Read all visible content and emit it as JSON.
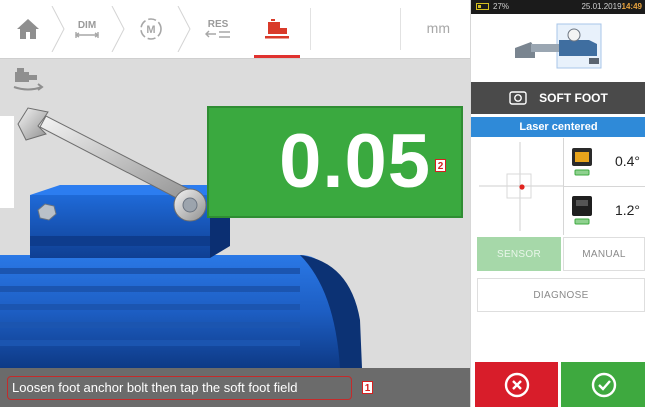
{
  "toolbar": {
    "dim_label": "DIM",
    "res_label": "RES",
    "units": "mm"
  },
  "measurement": {
    "value": "0.05",
    "callout": "2"
  },
  "status_bar": {
    "instruction": "Loosen foot anchor bolt then tap the soft foot field",
    "callout": "1"
  },
  "device_status": {
    "battery": "27%",
    "date": "25.01.2019",
    "time": "14:49"
  },
  "panel": {
    "title": "SOFT FOOT",
    "laser_status": "Laser centered",
    "angle_top": "0.4°",
    "angle_bottom": "1.2°",
    "sensor_label": "SENSOR",
    "manual_label": "MANUAL",
    "diagnose_label": "DIAGNOSE"
  },
  "colors": {
    "value_box": "#3aa93f",
    "laser_bar": "#2f8ad8",
    "cancel": "#d81d2a",
    "confirm": "#3ea93f",
    "accent_underline": "#e0322f"
  },
  "icons": [
    "home-icon",
    "dimensions-icon",
    "machine-m-icon",
    "results-icon",
    "soft-foot-icon",
    "machine-rotate-icon",
    "soft-foot-gauge-icon",
    "sensor-icon",
    "prism-icon",
    "cancel-icon",
    "confirm-icon"
  ]
}
